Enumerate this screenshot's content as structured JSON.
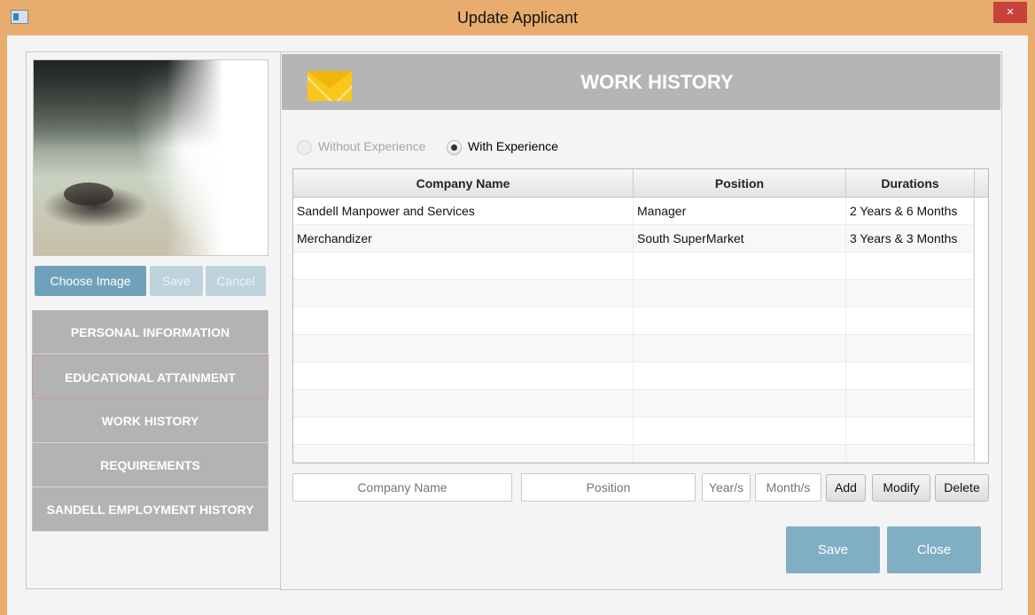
{
  "window": {
    "title": "Update Applicant",
    "close_glyph": "×"
  },
  "photo_buttons": {
    "choose": "Choose Image",
    "save": "Save",
    "cancel": "Cancel"
  },
  "nav": {
    "items": [
      {
        "label": "PERSONAL INFORMATION"
      },
      {
        "label": "EDUCATIONAL ATTAINMENT"
      },
      {
        "label": "WORK HISTORY"
      },
      {
        "label": "REQUIREMENTS"
      },
      {
        "label": "SANDELL EMPLOYMENT HISTORY"
      }
    ]
  },
  "header": {
    "title": "WORK HISTORY",
    "icon": "envelope-icon"
  },
  "experience": {
    "without_label": "Without Experience",
    "with_label": "With Experience",
    "selected": "With Experience"
  },
  "table": {
    "columns": [
      "Company Name",
      "Position",
      "Durations"
    ],
    "rows": [
      {
        "company": "Sandell Manpower and Services",
        "position": "Manager",
        "duration": "2 Years & 6 Months"
      },
      {
        "company": "Merchandizer",
        "position": "South SuperMarket",
        "duration": "3 Years & 3 Months"
      }
    ]
  },
  "form": {
    "company_placeholder": "Company Name",
    "position_placeholder": "Position",
    "years_placeholder": "Year/s",
    "months_placeholder": "Month/s",
    "add": "Add",
    "modify": "Modify",
    "delete": "Delete"
  },
  "footer": {
    "save": "Save",
    "close": "Close"
  },
  "colors": {
    "accent": "#80afc4",
    "nav_bg": "#b3b3b3",
    "header_bg": "#b5b5b5",
    "title_bar": "#e8ac6e"
  }
}
